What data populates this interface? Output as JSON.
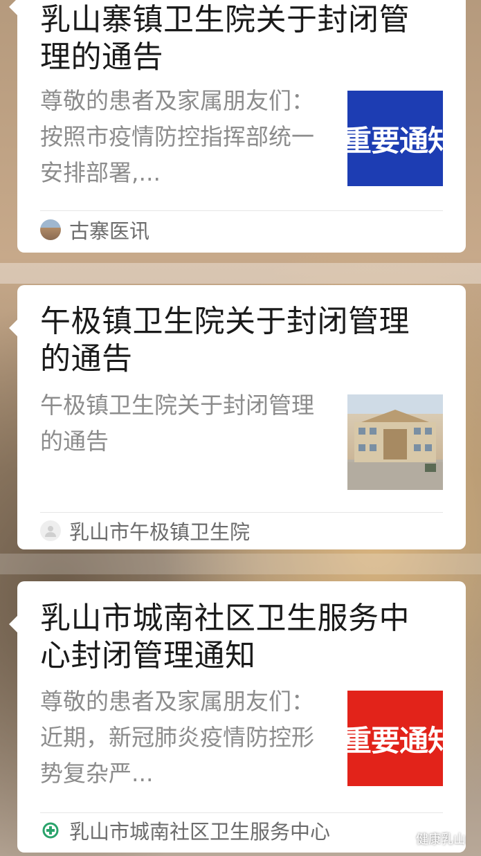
{
  "articles": [
    {
      "title": "乳山寨镇卫生院关于封闭管理的通告",
      "summary": "尊敬的患者及家属朋友们：　　按照市疫情防控指挥部统一安排部署,...",
      "thumbnail_text": "重要通知",
      "thumbnail_color": "#1d3db3",
      "source": "古寨医讯",
      "source_icon": "building-photo-icon"
    },
    {
      "title": "午极镇卫生院关于封闭管理的通告",
      "summary": "午极镇卫生院关于封闭管理的通告",
      "thumbnail_text": "",
      "thumbnail_color": "",
      "source": "乳山市午极镇卫生院",
      "source_icon": "default-avatar-icon"
    },
    {
      "title": "乳山市城南社区卫生服务中心封闭管理通知",
      "summary": "尊敬的患者及家属朋友们：　　近期，新冠肺炎疫情防控形势复杂严...",
      "thumbnail_text": "重要通知",
      "thumbnail_color": "#e2231a",
      "source": "乳山市城南社区卫生服务中心",
      "source_icon": "community-health-logo-icon"
    }
  ],
  "watermark": {
    "text": "健康乳山",
    "icon": "wechat-icon"
  }
}
